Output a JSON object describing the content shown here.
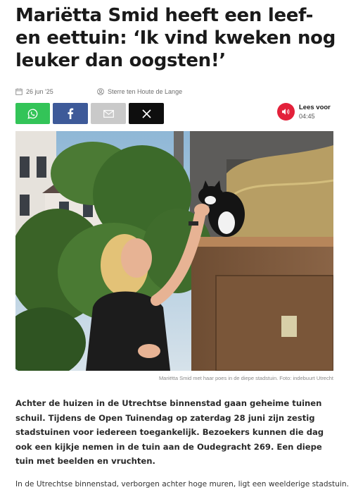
{
  "article": {
    "title": "Mariëtta Smid heeft een leef- en eettuin: ‘Ik vind kweken nog leuker dan oogsten!’",
    "date": "26 jun '25",
    "author": "Sterre ten Houte de Lange",
    "caption": "Mariëtta Smid met haar poes in de diepe stadstuin. Foto: indebuurt Utrecht",
    "lead": "Achter de huizen in de Utrechtse binnenstad gaan geheime tuinen schuil. Tijdens de Open Tuinendag op zaterdag 28 juni zijn zestig stadstuinen voor iedereen toegankelijk. Bezoekers kunnen die dag ook een kijkje nemen in de tuin aan de Oudegracht 269. Een diepe tuin met beelden en vruchten.",
    "body_first_line": "In de Utrechtse binnenstad, verborgen achter hoge muren, ligt een weelderige stadstuin."
  },
  "share": {
    "buttons": [
      {
        "name": "whatsapp",
        "icon": "whatsapp-icon",
        "color": "#33c458"
      },
      {
        "name": "facebook",
        "icon": "facebook-icon",
        "color": "#3e5a99"
      },
      {
        "name": "email",
        "icon": "mail-icon",
        "color": "#c9c9c9"
      },
      {
        "name": "x",
        "icon": "x-icon",
        "color": "#0e0e0e"
      }
    ]
  },
  "listen": {
    "label": "Lees voor",
    "duration": "04:45",
    "icon": "speaker-icon",
    "color": "#e3213a"
  },
  "meta_icons": {
    "date_icon": "calendar-icon",
    "author_icon": "user-icon"
  }
}
